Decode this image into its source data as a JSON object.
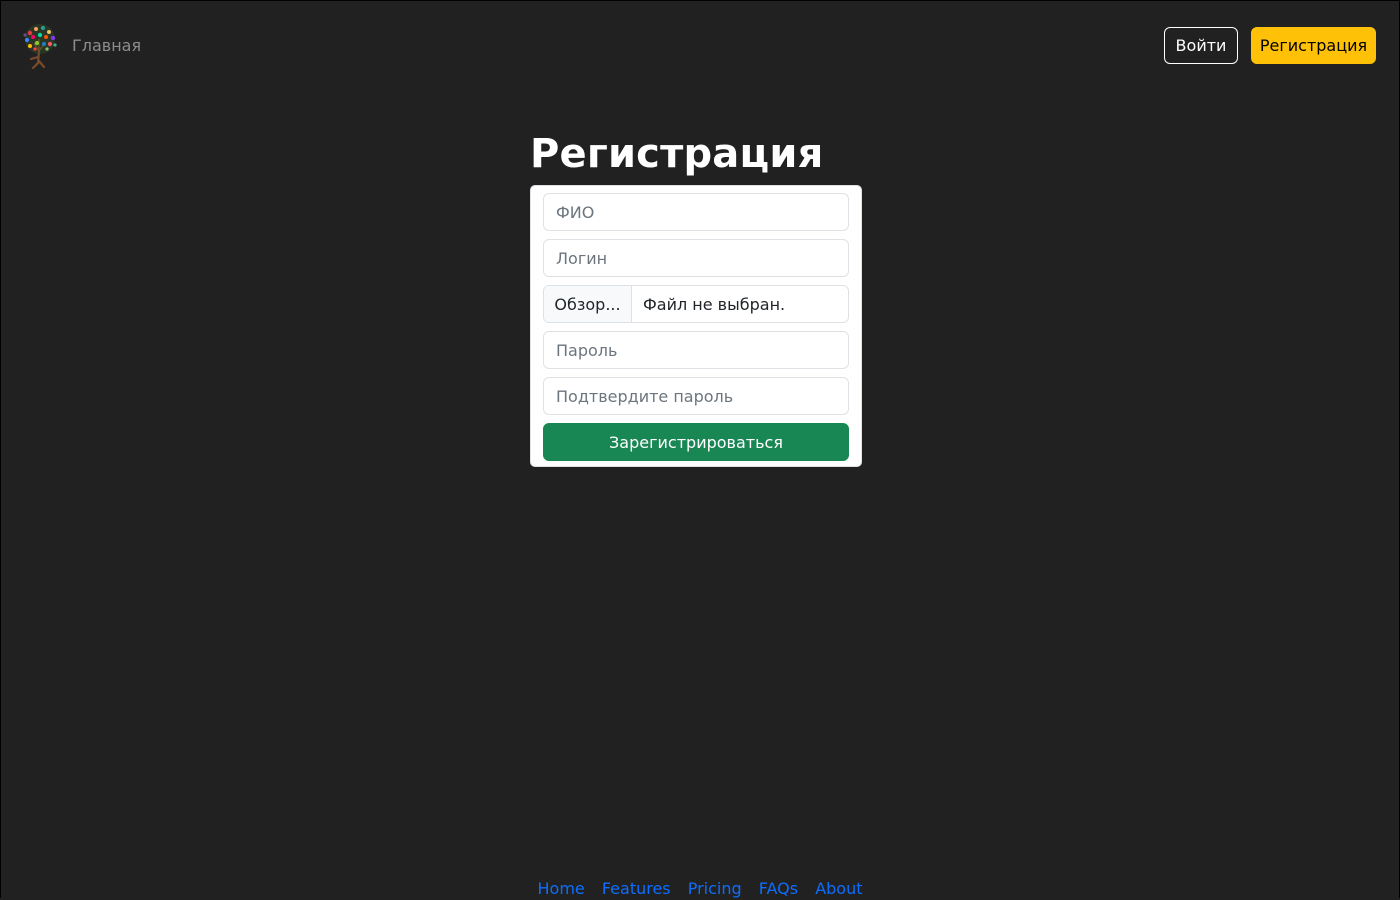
{
  "header": {
    "home_label": "Главная",
    "login_label": "Войти",
    "register_label": "Регистрация"
  },
  "page": {
    "title": "Регистрация"
  },
  "form": {
    "full_name_placeholder": "ФИО",
    "login_placeholder": "Логин",
    "file_browse_label": "Обзор...",
    "file_status": "Файл не выбран.",
    "password_placeholder": "Пароль",
    "confirm_password_placeholder": "Подтвердите пароль",
    "submit_label": "Зарегистрироваться"
  },
  "footer": {
    "links": [
      "Home",
      "Features",
      "Pricing",
      "FAQs",
      "About"
    ]
  },
  "colors": {
    "background": "#212121",
    "warning": "#ffc107",
    "success": "#198754",
    "link": "#0d6efd"
  },
  "icons": {
    "logo": "tree-logo-icon"
  }
}
